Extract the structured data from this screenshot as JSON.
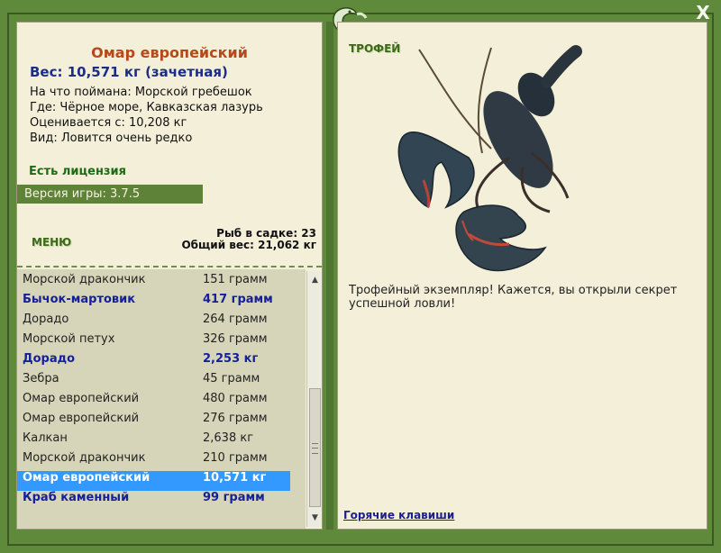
{
  "window": {
    "close_label": "X"
  },
  "fish": {
    "title": "Омар европейский",
    "weight": "Вес: 10,571 кг (зачетная)",
    "info": [
      "На что поймана: Морской гребешок",
      "Где: Чёрное море, Кавказская лазурь",
      "Оценивается с: 10,208 кг",
      "Вид: Ловится очень редко"
    ]
  },
  "license": "Есть лицензия",
  "version": "Версия игры: 3.7.5",
  "menu_label": "МЕНЮ",
  "cage": {
    "count": "Рыб в садке: 23",
    "total": "Общий вес: 21,062 кг"
  },
  "catch_list": [
    {
      "name": "Морской драконч ик",
      "weight": "151 грамм",
      "style": "normal"
    },
    {
      "name": "Бычок-мартовик",
      "weight": "417 грамм",
      "style": "bold"
    },
    {
      "name": "Дорадо",
      "weight": "264 грамм",
      "style": "normal"
    },
    {
      "name": "Морской петух",
      "weight": "326 грамм",
      "style": "normal"
    },
    {
      "name": "Дорадо",
      "weight": "2,253 кг",
      "style": "bold"
    },
    {
      "name": "Зебра",
      "weight": "45 грамм",
      "style": "normal"
    },
    {
      "name": "Омар европейский",
      "weight": "480 грамм",
      "style": "normal"
    },
    {
      "name": "Омар европейский",
      "weight": "276 грамм",
      "style": "normal"
    },
    {
      "name": "Калкан",
      "weight": "2,638 кг",
      "style": "normal"
    },
    {
      "name": "Морской дракончик",
      "weight": "210 грамм",
      "style": "normal"
    },
    {
      "name": "Омар европейский",
      "weight": "10,571 кг",
      "style": "selected"
    },
    {
      "name": "Краб каменный",
      "weight": "99 грамм",
      "style": "bold"
    }
  ],
  "trophy": {
    "label": "ТРОФЕЙ",
    "text": "Трофейный экземпляр! Кажется, вы открыли секрет успешной ловли!"
  },
  "hotkeys_label": "Горячие клавиши",
  "colors": {
    "frame": "#5f8a3c",
    "panel": "#f3efd9",
    "title": "#b5491b",
    "weight": "#1b2d87",
    "selected": "#3399ff"
  }
}
